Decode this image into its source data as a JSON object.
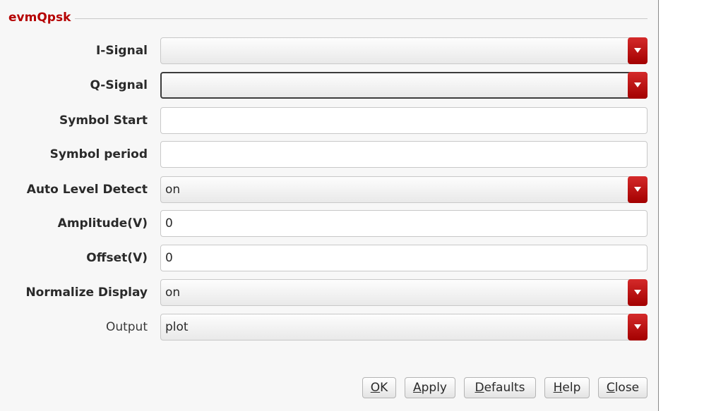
{
  "group": {
    "title": "evmQpsk"
  },
  "fields": [
    {
      "label": "I-Signal",
      "value": "",
      "kind": "combo"
    },
    {
      "label": "Q-Signal",
      "value": "",
      "kind": "combo"
    },
    {
      "label": "Symbol Start",
      "value": "",
      "kind": "text"
    },
    {
      "label": "Symbol period",
      "value": "",
      "kind": "text"
    },
    {
      "label": "Auto Level Detect",
      "value": "on",
      "kind": "combo"
    },
    {
      "label": "Amplitude(V)",
      "value": "0",
      "kind": "text"
    },
    {
      "label": "Offset(V)",
      "value": "0",
      "kind": "text"
    },
    {
      "label": "Normalize Display",
      "value": "on",
      "kind": "combo"
    },
    {
      "label": "Output",
      "value": "plot",
      "kind": "combo"
    }
  ],
  "buttons": {
    "ok": {
      "mnemonic": "O",
      "rest": "K"
    },
    "apply": {
      "mnemonic": "A",
      "rest": "pply"
    },
    "defaults": {
      "mnemonic": "D",
      "rest": "efaults"
    },
    "help": {
      "mnemonic": "H",
      "rest": "elp"
    },
    "close": {
      "mnemonic": "C",
      "rest": "lose"
    }
  },
  "colors": {
    "accent": "#b50000",
    "dropdown_arrow": "#c01010"
  }
}
